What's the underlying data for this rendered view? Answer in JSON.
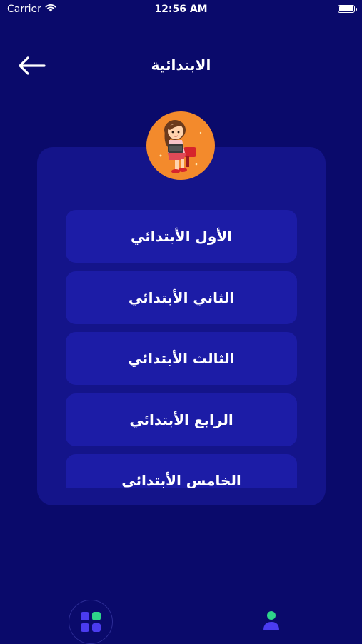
{
  "status_bar": {
    "carrier": "Carrier",
    "time": "12:56 AM"
  },
  "header": {
    "title": "الابتدائية",
    "back_icon": "arrow-left-icon"
  },
  "avatar": {
    "icon": "student-girl-illustration",
    "background_color": "#f38a2c"
  },
  "grades": [
    {
      "label": "الأول الأبتدائي"
    },
    {
      "label": "الثاني الأبتدائي"
    },
    {
      "label": "الثالث الأبتدائي"
    },
    {
      "label": "الرابع الأبتدائي"
    },
    {
      "label": "الخامس الأبتدائي"
    }
  ],
  "bottom_nav": {
    "home_icon": "grid-icon",
    "profile_icon": "user-icon"
  },
  "colors": {
    "background": "#0a0a6b",
    "card": "#14148a",
    "item": "#1c1ca6",
    "accent_green": "#2fd38a",
    "accent_blue": "#4b3cf0"
  }
}
